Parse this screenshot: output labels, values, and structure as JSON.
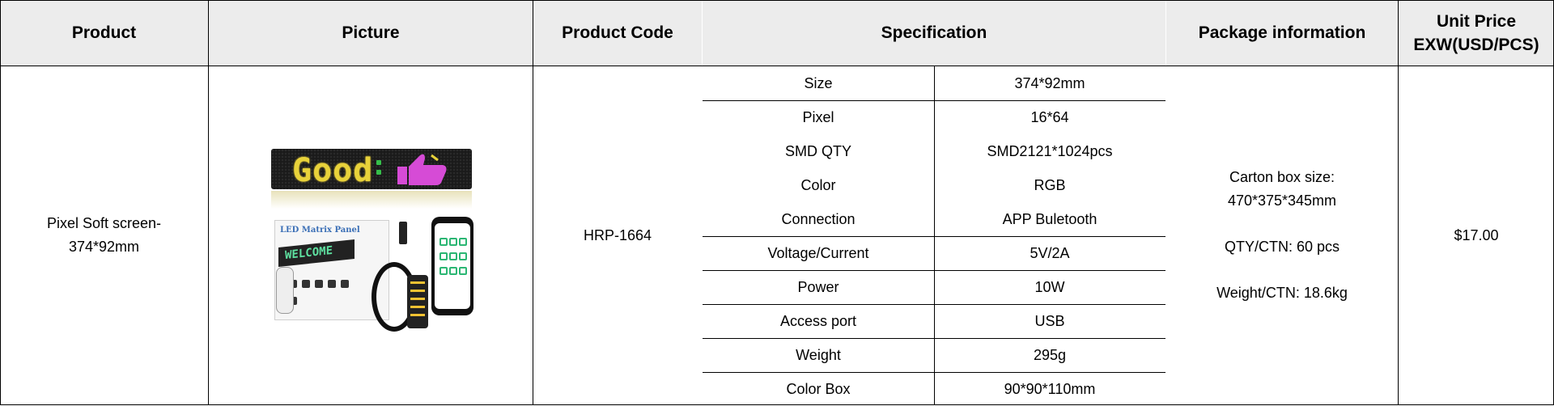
{
  "headers": {
    "product": "Product",
    "picture": "Picture",
    "product_code": "Product Code",
    "specification": "Specification",
    "package": "Package information",
    "unit_price_line1": "Unit Price",
    "unit_price_line2": "EXW(USD/PCS)"
  },
  "row": {
    "product_line1": "Pixel Soft screen-",
    "product_line2": "374*92mm",
    "product_code": "HRP-1664",
    "picture": {
      "display_text": "Good",
      "box_title": "LED Matrix Panel",
      "ribbon_text": "WELCOME"
    },
    "specs": [
      {
        "label": "Size",
        "value": "374*92mm"
      },
      {
        "label": "Pixel",
        "value": "16*64"
      },
      {
        "label": "SMD QTY",
        "value": "SMD2121*1024pcs"
      },
      {
        "label": "Color",
        "value": "RGB"
      },
      {
        "label": "Connection",
        "value": "APP Buletooth"
      },
      {
        "label": "Voltage/Current",
        "value": "5V/2A"
      },
      {
        "label": "Power",
        "value": "10W"
      },
      {
        "label": "Access port",
        "value": "USB"
      },
      {
        "label": "Weight",
        "value": "295g"
      },
      {
        "label": "Color Box",
        "value": "90*90*110mm"
      }
    ],
    "package": {
      "carton_line1": "Carton box size:",
      "carton_line2": "470*375*345mm",
      "qty": "QTY/CTN: 60 pcs",
      "weight": "Weight/CTN: 18.6kg"
    },
    "unit_price": "$17.00"
  },
  "colors": {
    "header_bg": "#ececec",
    "grid": "#000000",
    "led_yellow": "#e8d23a",
    "led_thumb": "#d64bd6"
  }
}
